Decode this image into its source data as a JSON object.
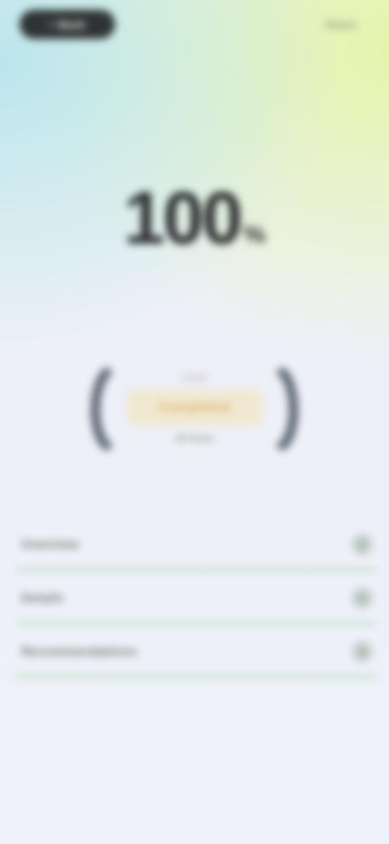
{
  "header": {
    "back_label": "Back",
    "back_icon": "chevron-left-icon",
    "action_label": "Share"
  },
  "stat": {
    "value": "100",
    "unit": "%"
  },
  "badge": {
    "label": "Level",
    "title": "Completed",
    "subtitle": "All done"
  },
  "list": {
    "items": [
      {
        "label": "Overview",
        "icon": "chevron-right-icon"
      },
      {
        "label": "Details",
        "icon": "chevron-right-icon"
      },
      {
        "label": "Recommendations",
        "icon": "chevron-right-icon"
      }
    ]
  },
  "colors": {
    "accent_gold": "#d6b46a",
    "divider_green": "#96cd96",
    "dark": "#2f3334"
  }
}
